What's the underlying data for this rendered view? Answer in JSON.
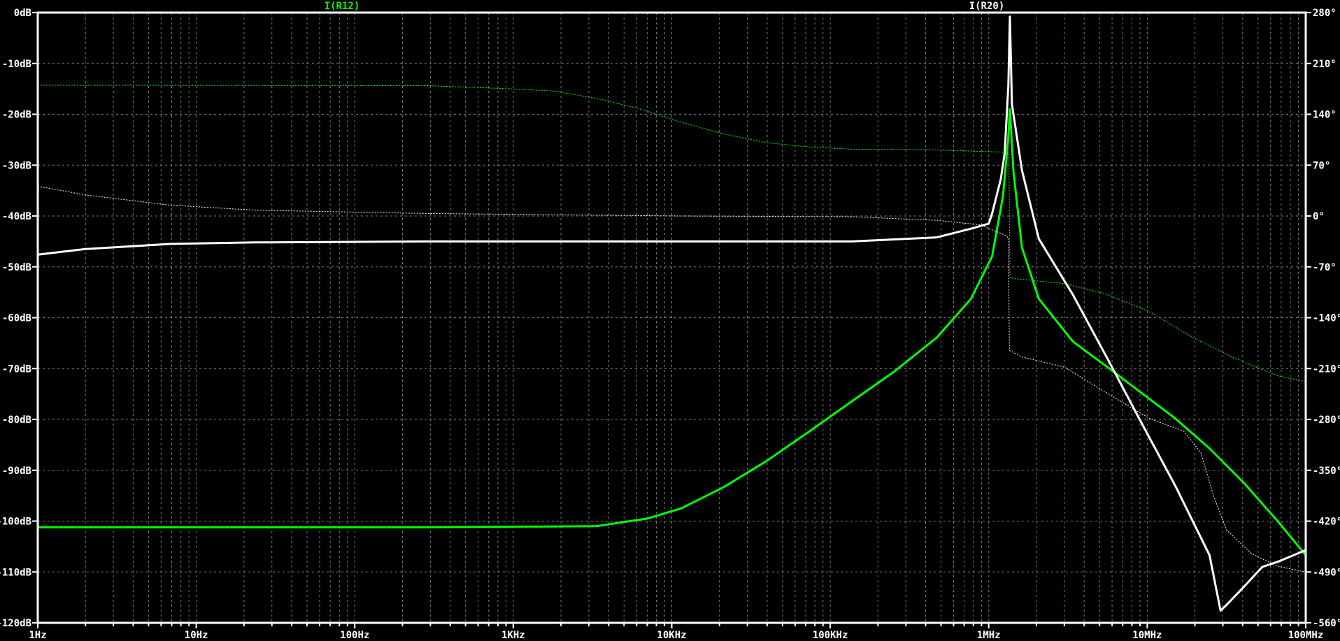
{
  "chart_data": {
    "type": "line",
    "title": "",
    "x_scale": "log",
    "xlim": [
      1,
      100000000
    ],
    "x_tick_labels": [
      "1Hz",
      "10Hz",
      "100Hz",
      "1KHz",
      "10KHz",
      "100KHz",
      "1MHz",
      "10MHz",
      "100MHz"
    ],
    "y_left": {
      "unit": "dB",
      "ylim": [
        -120,
        0
      ],
      "tick_labels": [
        "0dB",
        "-10dB",
        "-20dB",
        "-30dB",
        "-40dB",
        "-50dB",
        "-60dB",
        "-70dB",
        "-80dB",
        "-90dB",
        "-100dB",
        "-110dB",
        "-120dB"
      ]
    },
    "y_right": {
      "unit": "degrees",
      "ylim": [
        -560,
        280
      ],
      "tick_labels": [
        "280°",
        "210°",
        "140°",
        "70°",
        "0°",
        "-70°",
        "-140°",
        "-210°",
        "-280°",
        "-350°",
        "-420°",
        "-490°",
        "-560°"
      ]
    },
    "grid": true,
    "background": "#000000",
    "grid_color": "#808080",
    "series": [
      {
        "name": "I(R12)",
        "color": "#00ff00",
        "magnitude": [
          [
            1,
            -101.2
          ],
          [
            280,
            -101.2
          ],
          [
            3325,
            -101
          ],
          [
            6980,
            -99.5
          ],
          [
            11460,
            -97.5
          ],
          [
            21300,
            -93.3
          ],
          [
            39500,
            -88.2
          ],
          [
            73400,
            -82.4
          ],
          [
            136000,
            -76.5
          ],
          [
            253000,
            -70.6
          ],
          [
            470000,
            -63.9
          ],
          [
            771000,
            -56.3
          ],
          [
            1050000,
            -47.9
          ],
          [
            1230000,
            -36.1
          ],
          [
            1330000,
            -24.4
          ],
          [
            1360000,
            -19
          ],
          [
            1430000,
            -31.1
          ],
          [
            1620000,
            -46.2
          ],
          [
            2070000,
            -56.3
          ],
          [
            3400000,
            -64.7
          ],
          [
            5600000,
            -69.7
          ],
          [
            9200000,
            -74.8
          ],
          [
            15000000,
            -79.8
          ],
          [
            24700000,
            -85.7
          ],
          [
            40500000,
            -92.4
          ],
          [
            66500000,
            -100
          ],
          [
            100000000,
            -106.7
          ]
        ],
        "phase": [
          [
            1,
            180
          ],
          [
            280,
            179.5
          ],
          [
            964,
            175
          ],
          [
            1790,
            172
          ],
          [
            3325,
            162
          ],
          [
            6170,
            148
          ],
          [
            11460,
            129
          ],
          [
            21300,
            113
          ],
          [
            39500,
            101
          ],
          [
            73400,
            95
          ],
          [
            136000,
            92
          ],
          [
            470000,
            91
          ],
          [
            1190000,
            88
          ],
          [
            1340000,
            87
          ],
          [
            1360000,
            -85
          ],
          [
            1430000,
            -86
          ],
          [
            3000000,
            -93
          ],
          [
            5600000,
            -108
          ],
          [
            10400000,
            -132
          ],
          [
            19300000,
            -167
          ],
          [
            35800000,
            -196
          ],
          [
            66500000,
            -220
          ],
          [
            100000000,
            -228
          ]
        ]
      },
      {
        "name": "I(R20)",
        "color": "#ffffff",
        "magnitude": [
          [
            1,
            -47.6
          ],
          [
            2,
            -46.5
          ],
          [
            6.8,
            -45.5
          ],
          [
            23.5,
            -45.2
          ],
          [
            280,
            -45
          ],
          [
            136000,
            -45
          ],
          [
            470000,
            -44.2
          ],
          [
            771000,
            -42.5
          ],
          [
            1000000,
            -41.5
          ],
          [
            1050000,
            -39.5
          ],
          [
            1190000,
            -32.8
          ],
          [
            1260000,
            -27.7
          ],
          [
            1330000,
            -14.3
          ],
          [
            1360000,
            -0.8
          ],
          [
            1400000,
            -18
          ],
          [
            1620000,
            -31
          ],
          [
            2070000,
            -44.5
          ],
          [
            3400000,
            -55.5
          ],
          [
            5600000,
            -68
          ],
          [
            9200000,
            -80.7
          ],
          [
            15000000,
            -93
          ],
          [
            24700000,
            -106.7
          ],
          [
            29000000,
            -117.6
          ],
          [
            31600000,
            -116.5
          ],
          [
            40500000,
            -113
          ],
          [
            53200000,
            -109
          ],
          [
            66500000,
            -108
          ],
          [
            100000000,
            -105.7
          ]
        ],
        "phase": [
          [
            1,
            41
          ],
          [
            2,
            29
          ],
          [
            6.8,
            15
          ],
          [
            23.5,
            8
          ],
          [
            280,
            3.5
          ],
          [
            11460,
            0
          ],
          [
            136000,
            -1
          ],
          [
            470000,
            -6
          ],
          [
            873000,
            -12
          ],
          [
            1260000,
            -26
          ],
          [
            1330000,
            -30
          ],
          [
            1350000,
            -185
          ],
          [
            1620000,
            -194
          ],
          [
            3000000,
            -208
          ],
          [
            5600000,
            -244
          ],
          [
            10400000,
            -279
          ],
          [
            17000000,
            -296
          ],
          [
            21800000,
            -326
          ],
          [
            26200000,
            -385
          ],
          [
            31600000,
            -432
          ],
          [
            45800000,
            -465
          ],
          [
            66500000,
            -482
          ],
          [
            100000000,
            -490
          ]
        ]
      }
    ]
  }
}
